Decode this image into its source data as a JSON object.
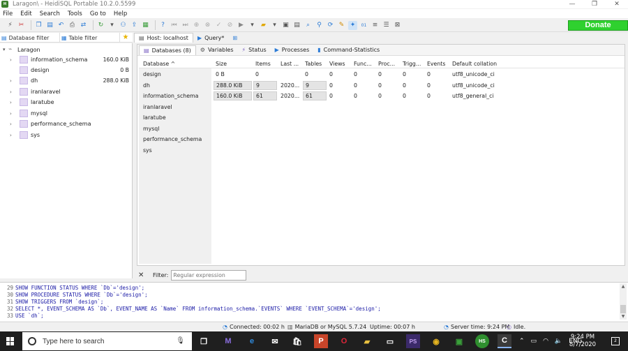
{
  "window": {
    "title": "Laragon\\ - HeidiSQL Portable 10.2.0.5599",
    "minimize": "—",
    "maximize": "❐",
    "close": "✕"
  },
  "menu": [
    "File",
    "Edit",
    "Search",
    "Tools",
    "Go to",
    "Help"
  ],
  "toolbar": {
    "donate_label": "Donate"
  },
  "left_panel": {
    "database_filter": "Database filter",
    "table_filter": "Table filter",
    "root": "Laragon",
    "databases": [
      {
        "name": "information_schema",
        "size": "160.0 KiB"
      },
      {
        "name": "design",
        "size": "0 B"
      },
      {
        "name": "dh",
        "size": "288.0 KiB"
      },
      {
        "name": "iranlaravel",
        "size": ""
      },
      {
        "name": "laratube",
        "size": ""
      },
      {
        "name": "mysql",
        "size": ""
      },
      {
        "name": "performance_schema",
        "size": ""
      },
      {
        "name": "sys",
        "size": ""
      }
    ]
  },
  "main_tabs": [
    {
      "label": "Host: localhost",
      "icon": "host-icon"
    },
    {
      "label": "Query*",
      "icon": "play-icon"
    }
  ],
  "sub_tabs": [
    {
      "label": "Databases (8)",
      "icon": "database-icon"
    },
    {
      "label": "Variables",
      "icon": "gear-icon"
    },
    {
      "label": "Status",
      "icon": "lightning-icon"
    },
    {
      "label": "Processes",
      "icon": "play-icon"
    },
    {
      "label": "Command-Statistics",
      "icon": "bar-chart-icon"
    }
  ],
  "grid": {
    "columns": [
      "Database ^",
      "Size",
      "Items",
      "Last ...",
      "Tables",
      "Views",
      "Func...",
      "Proc...",
      "Trigg...",
      "Events",
      "Default collation"
    ],
    "rows": [
      [
        "design",
        "0 B",
        "0",
        "",
        "0",
        "0",
        "0",
        "0",
        "0",
        "0",
        "utf8_unicode_ci"
      ],
      [
        "dh",
        "288.0 KiB",
        "9",
        "2020...",
        "9",
        "0",
        "0",
        "0",
        "0",
        "0",
        "utf8_unicode_ci"
      ],
      [
        "information_schema",
        "160.0 KiB",
        "61",
        "2020...",
        "61",
        "0",
        "0",
        "0",
        "0",
        "0",
        "utf8_general_ci"
      ],
      [
        "iranlaravel",
        "",
        "",
        "",
        "",
        "",
        "",
        "",
        "",
        "",
        ""
      ],
      [
        "laratube",
        "",
        "",
        "",
        "",
        "",
        "",
        "",
        "",
        "",
        ""
      ],
      [
        "mysql",
        "",
        "",
        "",
        "",
        "",
        "",
        "",
        "",
        "",
        ""
      ],
      [
        "performance_schema",
        "",
        "",
        "",
        "",
        "",
        "",
        "",
        "",
        "",
        ""
      ],
      [
        "sys",
        "",
        "",
        "",
        "",
        "",
        "",
        "",
        "",
        "",
        ""
      ]
    ]
  },
  "filter": {
    "label": "Filter:",
    "placeholder": "Regular expression"
  },
  "sql_log": [
    {
      "num": "29",
      "text": "SHOW FUNCTION STATUS WHERE `Db`='design';"
    },
    {
      "num": "30",
      "text": "SHOW PROCEDURE STATUS WHERE `Db`='design';"
    },
    {
      "num": "31",
      "text": "SHOW TRIGGERS FROM `design`;"
    },
    {
      "num": "32",
      "text": "SELECT *, EVENT_SCHEMA AS `Db`, EVENT_NAME AS `Name` FROM information_schema.`EVENTS` WHERE `EVENT_SCHEMA`='design';"
    },
    {
      "num": "33",
      "text": "USE `dh`;"
    }
  ],
  "status": {
    "connected": "Connected: 00:02 h",
    "server": "MariaDB or MySQL 5.7.24",
    "uptime": "Uptime: 00:07 h",
    "server_time": "Server time: 9:24 PM",
    "idle": "Idle."
  },
  "taskbar": {
    "search_placeholder": "Type here to search",
    "lang": "ENG",
    "time": "9:24 PM",
    "date": "8/7/2020",
    "notif_count": "2"
  }
}
